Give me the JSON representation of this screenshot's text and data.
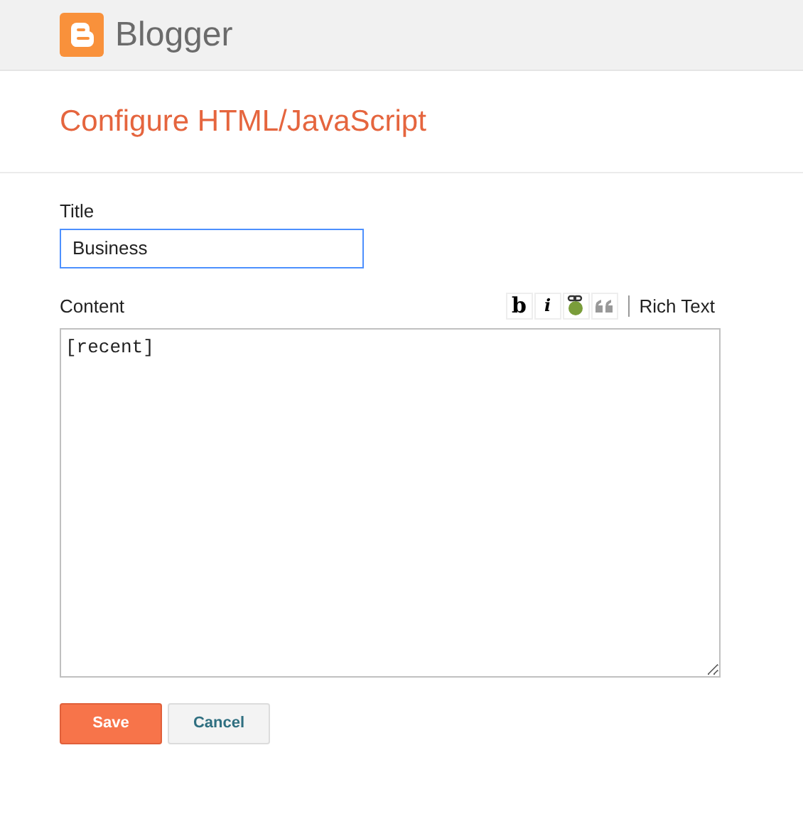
{
  "header": {
    "brand": "Blogger"
  },
  "page_title": "Configure HTML/JavaScript",
  "title_field": {
    "label": "Title",
    "value": "Business"
  },
  "content_field": {
    "label": "Content",
    "value": "[recent]"
  },
  "toolbar": [
    {
      "kind": "bold",
      "label": "b"
    },
    {
      "kind": "italic",
      "label": "i"
    },
    {
      "kind": "link"
    },
    {
      "kind": "quote"
    }
  ],
  "rich_text_link": "Rich Text",
  "buttons": [
    {
      "kind": "primary",
      "label": "Save"
    },
    {
      "kind": "secondary",
      "label": "Cancel"
    }
  ]
}
